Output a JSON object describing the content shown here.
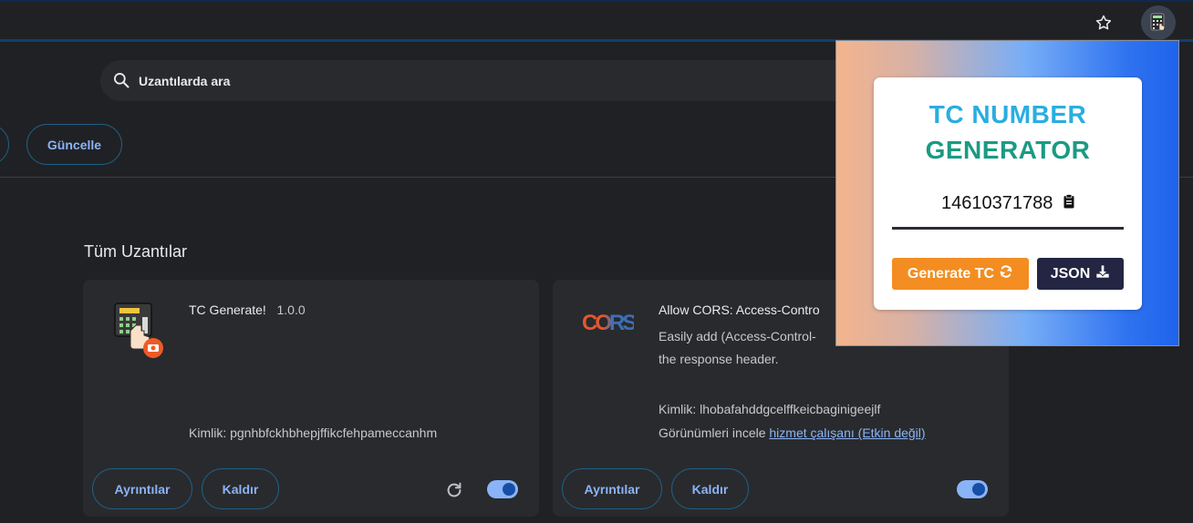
{
  "toolbar": {
    "star_icon": "star-outline-icon",
    "extension_icon": "calculator-extension-icon"
  },
  "search": {
    "placeholder": "Uzantılarda ara"
  },
  "actions": {
    "update_label": "Güncelle"
  },
  "section": {
    "title": "Tüm Uzantılar"
  },
  "extensions": [
    {
      "name": "TC Generate!",
      "version": "1.0.0",
      "id_label": "Kimlik: pgnhbfckhbhepjffikcfehpameccanhm",
      "details_label": "Ayrıntılar",
      "remove_label": "Kaldır",
      "enabled": true
    },
    {
      "name": "Allow CORS: Access-Contro",
      "logo_text": "CORS",
      "description_line1": "Easily add (Access-Control-",
      "description_line2": "the response header.",
      "id_label": "Kimlik: lhobafahddgcelffkeicbaginigeejlf",
      "inspect_label": "Görünümleri incele",
      "service_worker_link": "hizmet çalışanı (Etkin değil)",
      "details_label": "Ayrıntılar",
      "remove_label": "Kaldır",
      "enabled": true
    }
  ],
  "popup": {
    "title_line1": "TC NUMBER",
    "title_line2": "GENERATOR",
    "number": "14610371788",
    "generate_label": "Generate TC",
    "json_label": "JSON",
    "colors": {
      "title1": "#29aee0",
      "title2": "#1b9a84",
      "generate": "#f38d22",
      "json": "#232542"
    }
  }
}
